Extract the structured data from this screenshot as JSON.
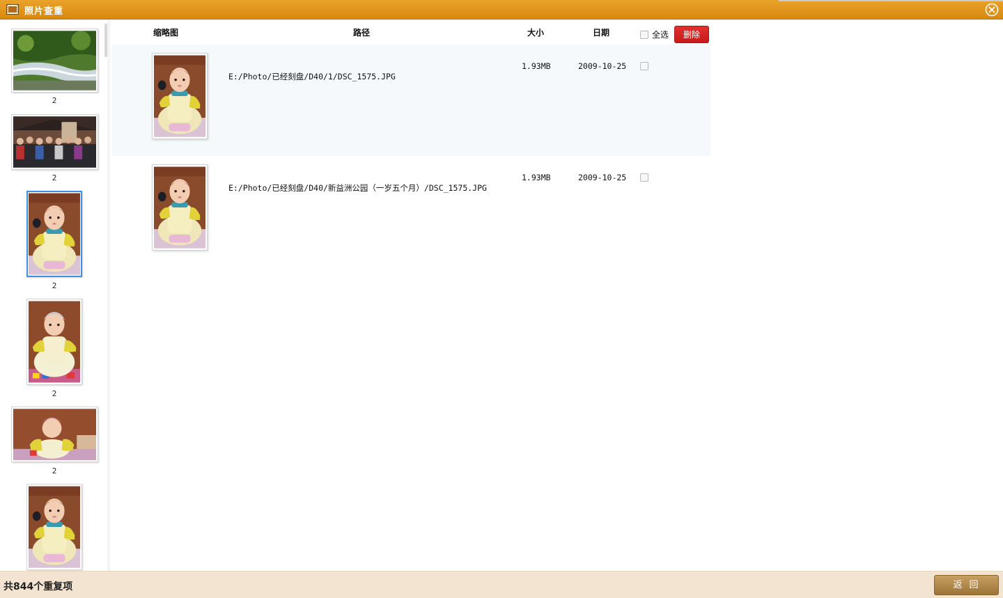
{
  "window": {
    "title": "照片查重",
    "icons": [
      "film-icon",
      "close-icon"
    ]
  },
  "sidebar": {
    "groups": [
      {
        "count": "2",
        "subject": "river-landscape"
      },
      {
        "count": "2",
        "subject": "group-photo"
      },
      {
        "count": "2",
        "subject": "baby-portrait",
        "selected": true
      },
      {
        "count": "2",
        "subject": "baby-portrait"
      },
      {
        "count": "2",
        "subject": "baby-with-hat"
      },
      {
        "count": "2",
        "subject": "baby-portrait"
      }
    ]
  },
  "table": {
    "columns": {
      "thumbnail": "缩略图",
      "path": "路径",
      "size": "大小",
      "date": "日期"
    },
    "select_all_label": "全选",
    "delete_label": "删除",
    "rows": [
      {
        "path": "E:/Photo/已经刻盘/D40/1/DSC_1575.JPG",
        "size": "1.93MB",
        "date": "2009-10-25"
      },
      {
        "path": "E:/Photo/已经刻盘/D40/新益洲公园（一岁五个月）/DSC_1575.JPG",
        "size": "1.93MB",
        "date": "2009-10-25"
      }
    ]
  },
  "status": {
    "summary": "共844个重复项",
    "back_label": "返回"
  },
  "colors": {
    "titlebar": "#e19618",
    "delete_button": "#d42424",
    "back_button": "#b58a4d",
    "statusbar": "#f3e4d1",
    "selection_border": "#3d8ee6"
  }
}
